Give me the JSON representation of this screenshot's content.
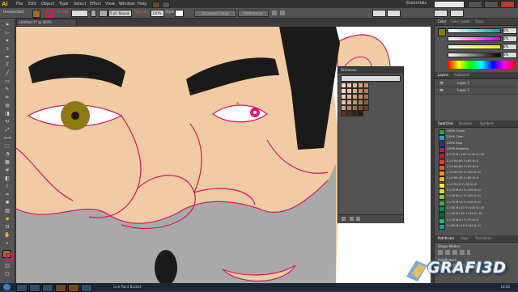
{
  "app": {
    "logo": "Ai",
    "workspace": "Essentials"
  },
  "menu": [
    "File",
    "Edit",
    "Object",
    "Type",
    "Select",
    "Effect",
    "View",
    "Window",
    "Help"
  ],
  "control_bar": {
    "selection_label": "Unselected",
    "stroke_label": "Stroke",
    "stroke_value": "",
    "brush_value": "5 pt. Round",
    "opacity_label": "Opacity",
    "opacity_value": "100%",
    "style_label": "Style",
    "doc_setup": "Document Setup",
    "prefs": "Preferences"
  },
  "document_tab": "Untitled-1* @ 400% (CMYK/Preview)",
  "swatch_library": {
    "title": "Skintones",
    "colors": [
      "#f2d9c4",
      "#ecc9ad",
      "#e2b896",
      "#d9a37c",
      "#cd9266",
      "#f5ddd0",
      "#e8c0a8",
      "#dca98c",
      "#c98c6b",
      "#b97a5a",
      "#f0cfb6",
      "#e3b99b",
      "#d5a27f",
      "#c48d67",
      "#a8704e",
      "#e6c3a3",
      "#d4aa84",
      "#c39068",
      "#a97a55",
      "#8c5e3d",
      "#c9a07c",
      "#b38660",
      "#9b6f4b",
      "#7f5537",
      "#6a4229",
      "#5a3824",
      "#4a2c1b",
      "#3b2214",
      "#2b180e"
    ]
  },
  "dock": {
    "color_tabs": [
      "Color",
      "Color Guide",
      "Trans"
    ],
    "color_values": [
      "0%",
      "0%",
      "0%",
      "0%"
    ],
    "layers_tabs": [
      "Layers",
      "Artboards"
    ],
    "layers": [
      "Layer 2",
      "Layer 1"
    ],
    "swatches_tabs": [
      "Swatches",
      "Brushes",
      "Symbols"
    ],
    "swatches": [
      {
        "name": "CMYK Green",
        "color": "#2aa24a"
      },
      {
        "name": "CMYK Cyan",
        "color": "#1aa3dd"
      },
      {
        "name": "CMYK Blue",
        "color": "#2e3192"
      },
      {
        "name": "CMYK Magenta",
        "color": "#c2185b"
      },
      {
        "name": "C=15 M=100 Y=90 K=10",
        "color": "#bf1e2e"
      },
      {
        "name": "C=0 M=90 Y=85 K=0",
        "color": "#ee3a2c"
      },
      {
        "name": "C=0 M=80 Y=95 K=0",
        "color": "#f15a24"
      },
      {
        "name": "C=0 M=50 Y=100 K=0",
        "color": "#f7941d"
      },
      {
        "name": "C=0 M=35 Y=85 K=0",
        "color": "#fbb040"
      },
      {
        "name": "C=5 M=0 Y=90 K=0",
        "color": "#f9ed32"
      },
      {
        "name": "C=20 M=0 Y=100 K=0",
        "color": "#d7df23"
      },
      {
        "name": "C=50 M=0 Y=100 K=0",
        "color": "#8dc63f"
      },
      {
        "name": "C=75 M=0 Y=100 K=0",
        "color": "#39b54a"
      },
      {
        "name": "C=85 M=10 Y=100 K=10",
        "color": "#009444"
      },
      {
        "name": "C=90 M=30 Y=95 K=30",
        "color": "#006838"
      },
      {
        "name": "C=75 M=0 Y=75 K=0",
        "color": "#2bb673"
      },
      {
        "name": "C=80 M=10 Y=45 K=0",
        "color": "#00a79d"
      }
    ],
    "pathfinder_tabs": [
      "Pathfinder",
      "Align",
      "Transform"
    ],
    "shape_modes_label": "Shape Modes:",
    "pathfinders_label": "Pathfinders:"
  },
  "taskbar": {
    "window_title": "Live Paint Bucket",
    "time": "13:35",
    "date": "31/01/2012"
  },
  "watermark": "GRAFI3D",
  "colors": {
    "skin": "#f1cba3",
    "outline": "#d3175f",
    "hair": "#1a1a1a",
    "iris": "#8b7a14",
    "beard": "#a9a9a9",
    "pink_iris": "#e0167a"
  }
}
